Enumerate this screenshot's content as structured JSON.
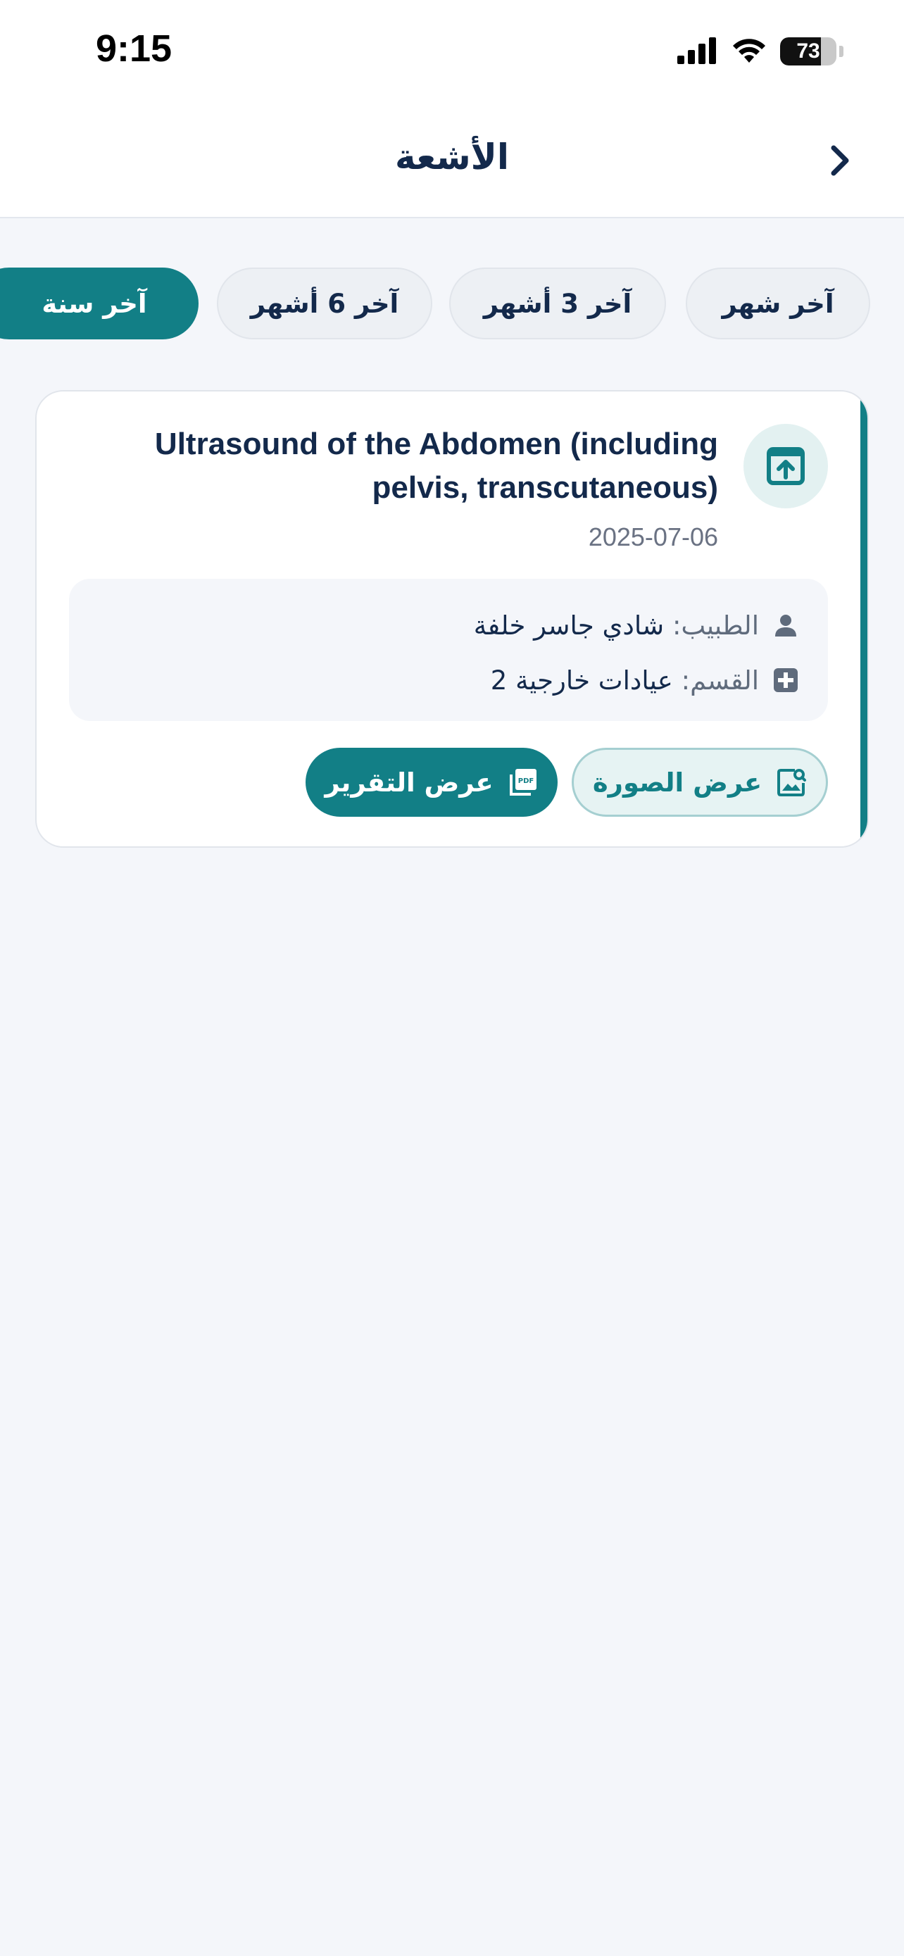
{
  "status_bar": {
    "time": "9:15",
    "battery_percent": 73,
    "battery_label": "73"
  },
  "header": {
    "title": "الأشعة",
    "back_icon": "chevron-right-icon"
  },
  "filters": [
    {
      "label": "آخر شهر",
      "active": false
    },
    {
      "label": "آخر 3 أشهر",
      "active": false
    },
    {
      "label": "آخر 6 أشهر",
      "active": false
    },
    {
      "label": "آخر سنة",
      "active": true
    }
  ],
  "report": {
    "title": "Ultrasound of the Abdomen (including pelvis, transcutaneous)",
    "date": "2025-07-06",
    "icon": "upload-box-icon",
    "doctor_label": "الطبيب:",
    "doctor_value": "شادي جاسر خلفة",
    "department_label": "القسم:",
    "department_value": "عيادات خارجية 2",
    "view_image_label": "عرض الصورة",
    "view_report_label": "عرض التقرير"
  },
  "colors": {
    "accent": "#127f86",
    "text": "#13294b",
    "background": "#f4f6fa"
  }
}
